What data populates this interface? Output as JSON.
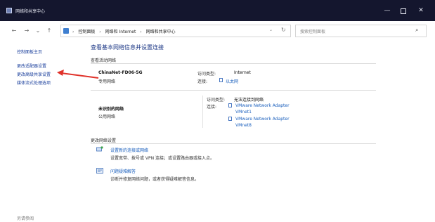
{
  "window": {
    "title": "网络和共享中心",
    "controls": {
      "minimize": "—",
      "maximize": "",
      "close": "✕"
    }
  },
  "nav": {
    "back": "←",
    "forward": "→",
    "recent": "⌄",
    "up": "↑",
    "breadcrumb": [
      "控制面板",
      "网络和 Internet",
      "网络和共享中心"
    ],
    "breadcrumb_sep": "›",
    "dropdown": "⌄",
    "refresh": "↻",
    "search_placeholder": "搜索控制面板",
    "search_icon": "⌕"
  },
  "sidebar": {
    "items": [
      {
        "label": "控制面板主页"
      },
      {
        "label": "更改适配器设置"
      },
      {
        "label": "更改高级共享设置"
      },
      {
        "label": "媒体流式处理选项"
      }
    ],
    "see_also": "另请参阅"
  },
  "main": {
    "heading": "查看基本网络信息并设置连接",
    "active_networks_label": "查看活动网络",
    "networks": [
      {
        "name": "ChinaNet-FD06-5G",
        "type": "专用网络",
        "access_type_label": "访问类型:",
        "access_type": "Internet",
        "connections_label": "连接:",
        "connections": [
          "以太网"
        ]
      },
      {
        "name": "未识别的网络",
        "type": "公用网络",
        "access_type_label": "访问类型:",
        "access_type": "无法连接到网络",
        "connections_label": "连接:",
        "connections": [
          "VMware Network Adapter",
          "VMnet1",
          "VMware Network Adapter",
          "VMnet8"
        ]
      }
    ],
    "change_settings_label": "更改网络设置",
    "tasks": [
      {
        "icon": "network-setup-icon",
        "link": "设置新的连接或网络",
        "desc": "设置宽带、拨号或 VPN 连接；或设置路由器或接入点。"
      },
      {
        "icon": "troubleshoot-icon",
        "link": "问题疑难解答",
        "desc": "诊断并修复网络问题，或者获得疑难解答信息。"
      }
    ]
  },
  "colors": {
    "titlebar": "#14162e",
    "link": "#1a5fbd",
    "heading": "#1f3a87",
    "arrow": "#e0322a"
  }
}
